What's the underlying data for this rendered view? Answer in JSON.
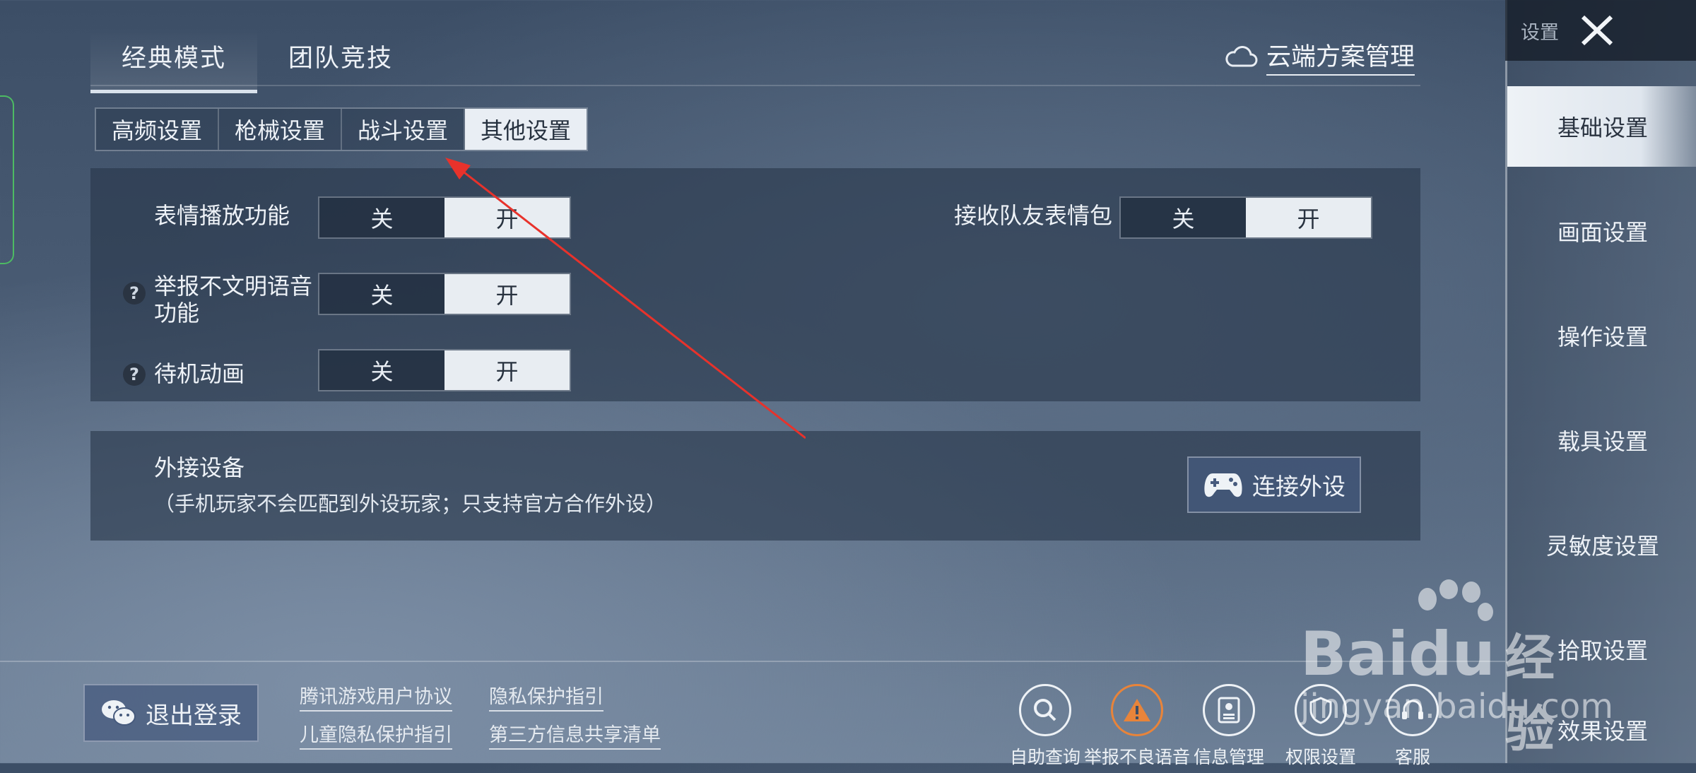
{
  "mode_tabs": [
    {
      "label": "经典模式",
      "active": true
    },
    {
      "label": "团队竞技",
      "active": false
    }
  ],
  "cloud": {
    "label": "云端方案管理",
    "icon": "cloud-icon"
  },
  "sub_tabs": [
    {
      "label": "高频设置",
      "active": false
    },
    {
      "label": "枪械设置",
      "active": false
    },
    {
      "label": "战斗设置",
      "active": false
    },
    {
      "label": "其他设置",
      "active": true
    }
  ],
  "settings": {
    "emote_play": {
      "label": "表情播放功能",
      "off": "关",
      "on": "开",
      "value": "开"
    },
    "teammate_emote": {
      "label": "接收队友表情包",
      "off": "关",
      "on": "开",
      "value": "开"
    },
    "report_voice": {
      "label_line1": "举报不文明语音",
      "label_line2": "功能",
      "off": "关",
      "on": "开",
      "value": "开"
    },
    "idle_anim": {
      "label": "待机动画",
      "off": "关",
      "on": "开",
      "value": "开"
    },
    "help_glyph": "?"
  },
  "external": {
    "title": "外接设备",
    "desc": "（手机玩家不会匹配到外设玩家；只支持官方合作外设）",
    "button": "连接外设",
    "button_icon": "gamepad-icon"
  },
  "sidebar": {
    "title": "设置",
    "items": [
      {
        "label": "基础设置",
        "active": true
      },
      {
        "label": "画面设置",
        "active": false
      },
      {
        "label": "操作设置",
        "active": false
      },
      {
        "label": "载具设置",
        "active": false
      },
      {
        "label": "灵敏度设置",
        "active": false
      },
      {
        "label": "拾取设置",
        "active": false
      },
      {
        "label": "效果设置",
        "active": false
      }
    ]
  },
  "bottom": {
    "logout": "退出登录",
    "logout_icon": "wechat-icon",
    "links": [
      "腾讯游戏用户协议",
      "隐私保护指引",
      "儿童隐私保护指引",
      "第三方信息共享清单"
    ],
    "icons": [
      {
        "label": "自助查询",
        "icon": "search-icon"
      },
      {
        "label": "举报不良语音",
        "icon": "warning-icon",
        "color": "#e8843a"
      },
      {
        "label": "信息管理",
        "icon": "id-card-icon"
      },
      {
        "label": "权限设置",
        "icon": "shield-icon"
      },
      {
        "label": "客服",
        "icon": "headset-icon"
      }
    ]
  },
  "watermark": {
    "brand": "Bai",
    "brand2": "du",
    "cn": "经验",
    "url": "jingyan.baidu.com"
  },
  "colors": {
    "accent_warn": "#e8843a",
    "annotation_arrow": "#e8322b",
    "left_frame": "#4dbb63"
  }
}
